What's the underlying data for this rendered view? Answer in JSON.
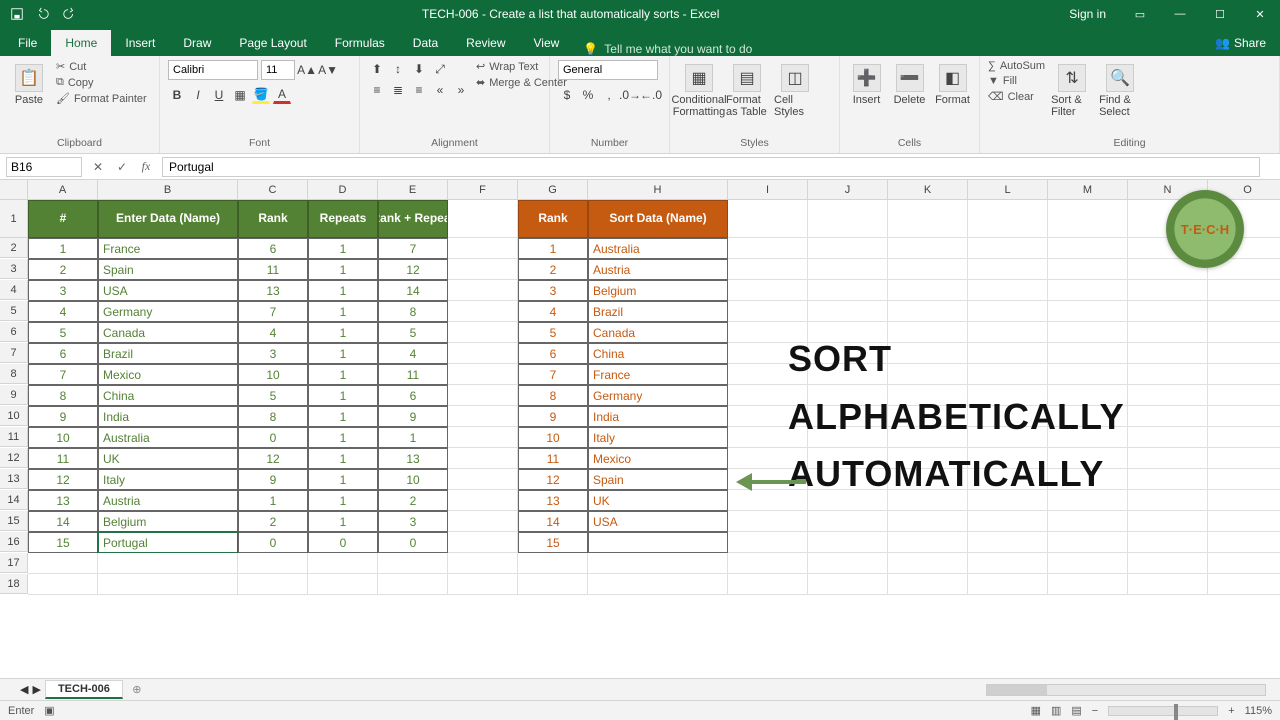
{
  "titlebar": {
    "title": "TECH-006 - Create a list that automatically sorts  -  Excel",
    "signin": "Sign in"
  },
  "tabs": {
    "file": "File",
    "home": "Home",
    "insert": "Insert",
    "draw": "Draw",
    "page_layout": "Page Layout",
    "formulas": "Formulas",
    "data": "Data",
    "review": "Review",
    "view": "View",
    "tellme": "Tell me what you want to do",
    "share": "Share"
  },
  "ribbon": {
    "clipboard": {
      "paste": "Paste",
      "cut": "Cut",
      "copy": "Copy",
      "fmtpainter": "Format Painter",
      "label": "Clipboard"
    },
    "font": {
      "name": "Calibri",
      "size": "11",
      "bold": "B",
      "italic": "I",
      "underline": "U",
      "label": "Font"
    },
    "alignment": {
      "wrap": "Wrap Text",
      "merge": "Merge & Center",
      "label": "Alignment"
    },
    "number": {
      "fmt": "General",
      "label": "Number"
    },
    "styles": {
      "cond": "Conditional Formatting",
      "fat": "Format as Table",
      "cell": "Cell Styles",
      "label": "Styles"
    },
    "cells": {
      "insert": "Insert",
      "delete": "Delete",
      "format": "Format",
      "label": "Cells"
    },
    "editing": {
      "sum": "AutoSum",
      "fill": "Fill",
      "clear": "Clear",
      "sort": "Sort & Filter",
      "find": "Find & Select",
      "label": "Editing"
    }
  },
  "formula_bar": {
    "name": "B16",
    "value": "Portugal"
  },
  "columns": [
    "A",
    "B",
    "C",
    "D",
    "E",
    "F",
    "G",
    "H",
    "I",
    "J",
    "K",
    "L",
    "M",
    "N",
    "O"
  ],
  "table1": {
    "headers": [
      "#",
      "Enter Data (Name)",
      "Rank",
      "Repeats",
      "Rank + Repeat"
    ],
    "rows": [
      [
        1,
        "France",
        6,
        1,
        7
      ],
      [
        2,
        "Spain",
        11,
        1,
        12
      ],
      [
        3,
        "USA",
        13,
        1,
        14
      ],
      [
        4,
        "Germany",
        7,
        1,
        8
      ],
      [
        5,
        "Canada",
        4,
        1,
        5
      ],
      [
        6,
        "Brazil",
        3,
        1,
        4
      ],
      [
        7,
        "Mexico",
        10,
        1,
        11
      ],
      [
        8,
        "China",
        5,
        1,
        6
      ],
      [
        9,
        "India",
        8,
        1,
        9
      ],
      [
        10,
        "Australia",
        0,
        1,
        1
      ],
      [
        11,
        "UK",
        12,
        1,
        13
      ],
      [
        12,
        "Italy",
        9,
        1,
        10
      ],
      [
        13,
        "Austria",
        1,
        1,
        2
      ],
      [
        14,
        "Belgium",
        2,
        1,
        3
      ],
      [
        15,
        "Portugal",
        0,
        0,
        0
      ]
    ]
  },
  "table2": {
    "headers": [
      "Rank",
      "Sort Data (Name)"
    ],
    "rows": [
      [
        1,
        "Australia"
      ],
      [
        2,
        "Austria"
      ],
      [
        3,
        "Belgium"
      ],
      [
        4,
        "Brazil"
      ],
      [
        5,
        "Canada"
      ],
      [
        6,
        "China"
      ],
      [
        7,
        "France"
      ],
      [
        8,
        "Germany"
      ],
      [
        9,
        "India"
      ],
      [
        10,
        "Italy"
      ],
      [
        11,
        "Mexico"
      ],
      [
        12,
        "Spain"
      ],
      [
        13,
        "UK"
      ],
      [
        14,
        "USA"
      ],
      [
        15,
        ""
      ]
    ]
  },
  "overlay": {
    "line1": "SORT",
    "line2": "ALPHABETICALLY",
    "line3": "AUTOMATICALLY",
    "logo": "T·E·C·H"
  },
  "sheettabs": {
    "name": "TECH-006"
  },
  "status": {
    "mode": "Enter",
    "zoom": "115%"
  }
}
